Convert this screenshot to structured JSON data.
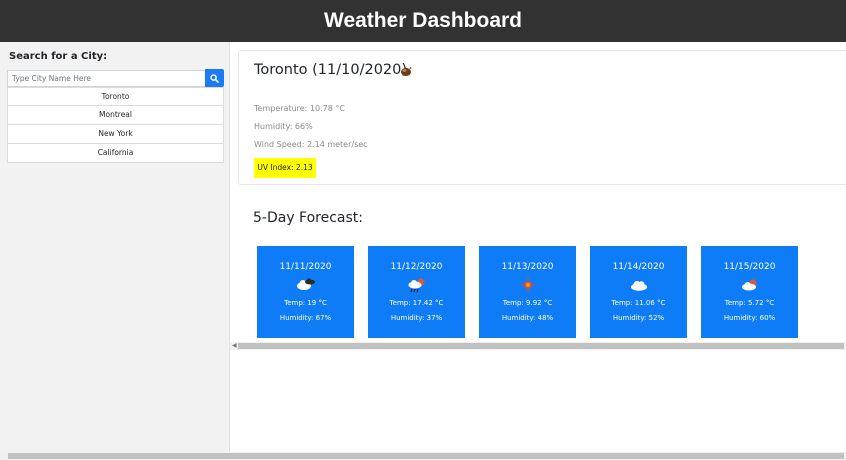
{
  "header": {
    "title": "Weather Dashboard"
  },
  "sidebar": {
    "search_label": "Search for a City:",
    "search_placeholder": "Type City Name Here",
    "search_icon": "search-icon",
    "cities": [
      "Toronto",
      "Montreal",
      "New York",
      "California"
    ]
  },
  "current": {
    "title": "Toronto (11/10/2020)",
    "icon": "moon-clear-night-icon",
    "temperature": "Temperature: 10.78 °C",
    "humidity": "Humidity: 66%",
    "wind": "Wind Speed: 2.14 meter/sec",
    "uv": "UV Index: 2.13",
    "uv_color": "#ffff00"
  },
  "forecast": {
    "title": "5-Day Forecast:",
    "card_color": "#0f7cf7",
    "days": [
      {
        "date": "11/11/2020",
        "icon": "rain-cloud-icon",
        "temp": "Temp: 19 °C",
        "humidity": "Humidity: 67%"
      },
      {
        "date": "11/12/2020",
        "icon": "cloud-sun-rain-icon",
        "temp": "Temp: 17.42 °C",
        "humidity": "Humidity: 37%"
      },
      {
        "date": "11/13/2020",
        "icon": "sun-icon",
        "temp": "Temp: 9.92 °C",
        "humidity": "Humidity: 48%"
      },
      {
        "date": "11/14/2020",
        "icon": "cloud-icon",
        "temp": "Temp: 11.06 °C",
        "humidity": "Humidity: 52%"
      },
      {
        "date": "11/15/2020",
        "icon": "cloud-sun-icon",
        "temp": "Temp: 5.72 °C",
        "humidity": "Humidity: 60%"
      }
    ]
  }
}
